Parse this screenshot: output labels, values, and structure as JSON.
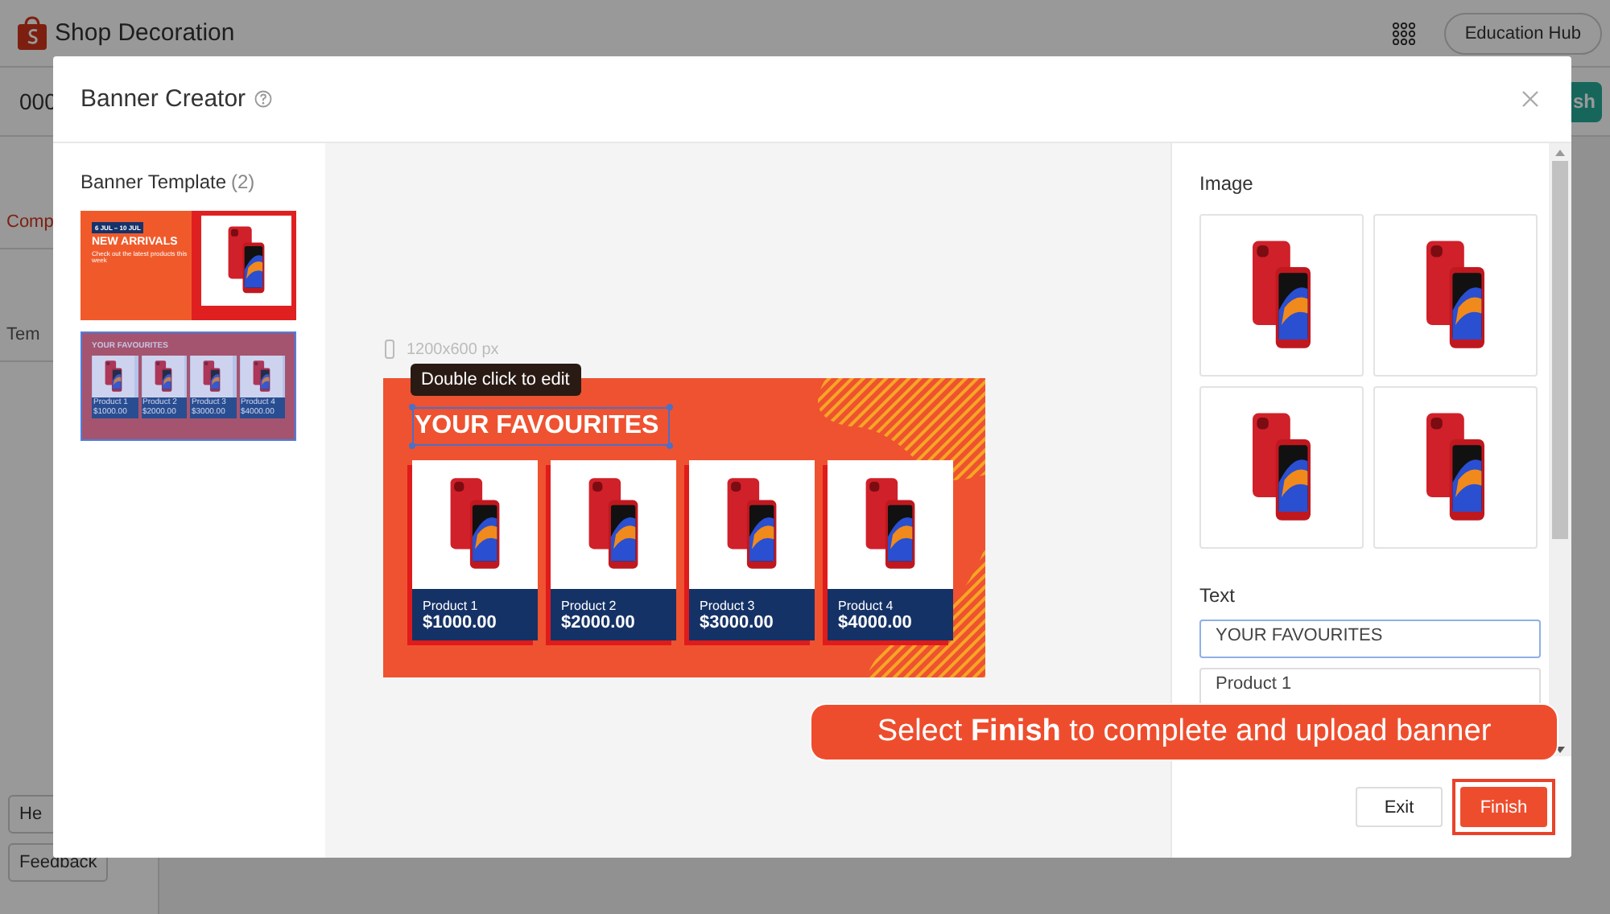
{
  "page": {
    "title": "Shop Decoration",
    "education_hub": "Education Hub",
    "tab_code": "000",
    "publish_button": "sh",
    "sidebar": [
      {
        "label": "Comp",
        "selected": true
      },
      {
        "label": "Tem",
        "selected": false
      }
    ],
    "help_button": "He",
    "feedback_button": "Feedback"
  },
  "modal": {
    "title": "Banner Creator",
    "templates_title": "Banner Template",
    "templates_count": "(2)",
    "templates": [
      {
        "kind": "arrivals",
        "selected": false,
        "date": "6 JUL – 10 JUL",
        "headline": "NEW ARRIVALS",
        "subline": "Check out the latest products this week"
      },
      {
        "kind": "favourites",
        "selected": true,
        "headline": "YOUR FAVOURITES",
        "products": [
          {
            "name": "Product 1",
            "price": "$1000.00"
          },
          {
            "name": "Product 2",
            "price": "$2000.00"
          },
          {
            "name": "Product 3",
            "price": "$3000.00"
          },
          {
            "name": "Product 4",
            "price": "$4000.00"
          }
        ]
      }
    ],
    "canvas": {
      "size": "1200x600 px",
      "tooltip": "Double click to edit",
      "headline": "YOUR FAVOURITES",
      "products": [
        {
          "name": "Product 1",
          "price": "$1000.00"
        },
        {
          "name": "Product 2",
          "price": "$2000.00"
        },
        {
          "name": "Product 3",
          "price": "$3000.00"
        },
        {
          "name": "Product 4",
          "price": "$4000.00"
        }
      ]
    },
    "image_title": "Image",
    "text_title": "Text",
    "text_fields": [
      {
        "value": "YOUR FAVOURITES",
        "focused": true
      },
      {
        "value": "Product 1",
        "focused": false
      }
    ],
    "exit_button": "Exit",
    "finish_button": "Finish"
  },
  "callout": {
    "text": "Select **Finish** to complete and upload banner"
  }
}
